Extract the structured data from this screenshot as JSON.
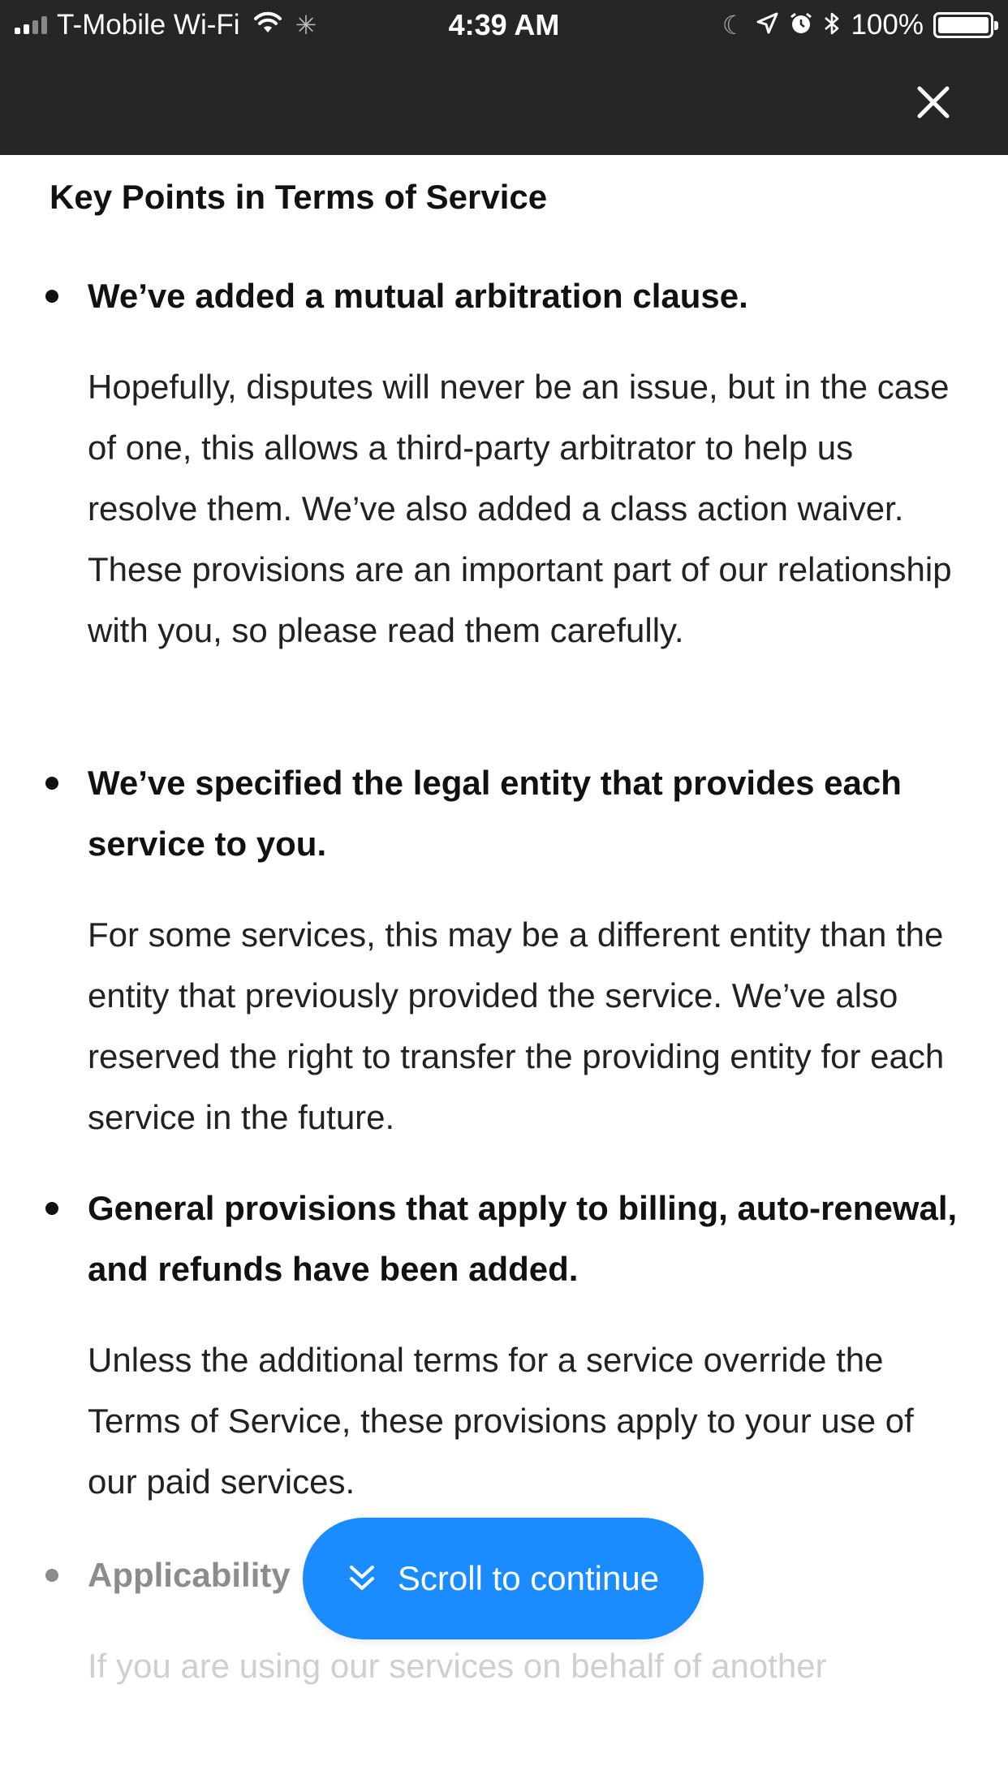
{
  "status_bar": {
    "carrier": "T-Mobile Wi-Fi",
    "time": "4:39 AM",
    "battery_percent": "100%"
  },
  "header": {
    "close_icon": "close-icon"
  },
  "page": {
    "title": "Key Points in Terms of Service",
    "sections": [
      {
        "heading": "We’ve added a mutual arbitration clause.",
        "body": "Hopefully, disputes will never be an issue, but in the case of one, this allows a third-party arbitrator to help us resolve them. We’ve also added a class action waiver. These provisions are an important part of our relationship with you, so please read them carefully."
      },
      {
        "heading": "We’ve specified the legal entity that provides each service to you.",
        "body": "For some services, this may be a different entity than the entity that previously provided the service. We’ve also reserved the right to transfer the providing entity for each service in the future."
      },
      {
        "heading": "General provisions that apply to billing, auto-renewal, and refunds have been added.",
        "body": "Unless the additional terms for a service override the Terms of Service, these provisions apply to your use of our paid services."
      },
      {
        "heading": "Applicability",
        "body": "If you are using our services on behalf of another"
      }
    ]
  },
  "scroll_button": {
    "label": "Scroll to continue",
    "icon": "double-chevron-down-icon"
  },
  "colors": {
    "bar_background": "#262626",
    "accent": "#1a8cff"
  }
}
